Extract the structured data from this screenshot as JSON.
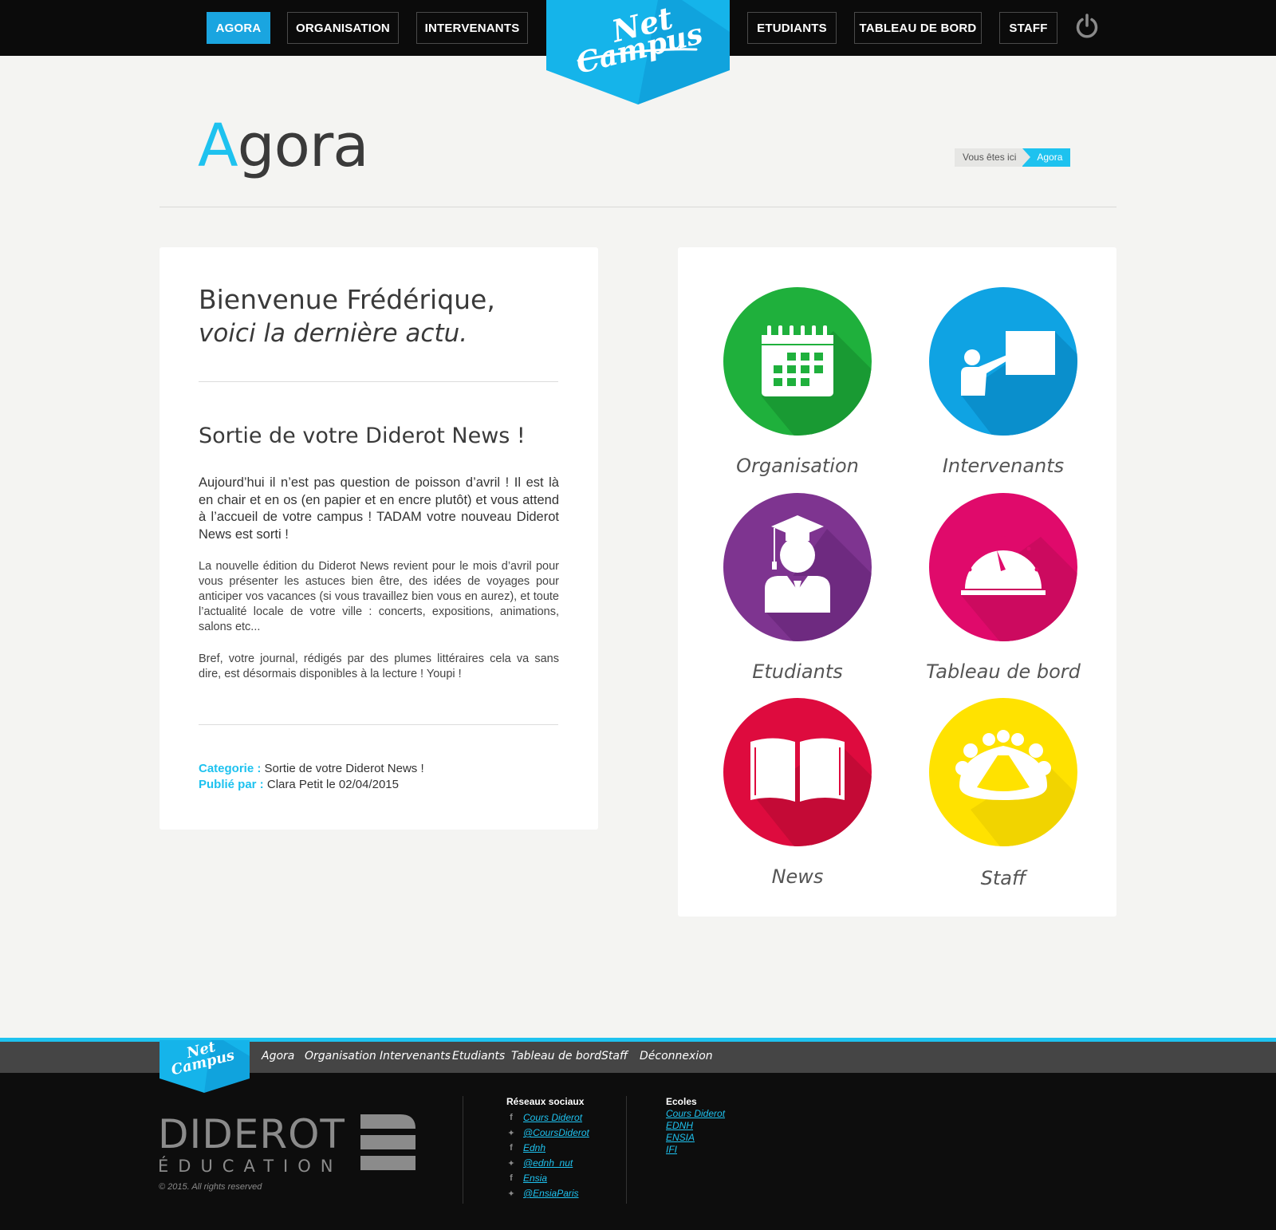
{
  "colors": {
    "accent": "#1ec2ef",
    "nav_active": "#1aa5e0",
    "topbar": "#0b0b0b",
    "green": "#1fb03c",
    "blue": "#0fa3e3",
    "purple": "#7e3490",
    "pink": "#e00a6b",
    "red": "#de0b3e",
    "yellow": "#ffe200"
  },
  "logo": {
    "line1": "Net",
    "line2": "Campus"
  },
  "nav": {
    "agora": "AGORA",
    "organisation": "ORGANISATION",
    "intervenants": "INTERVENANTS",
    "etudiants": "ETUDIANTS",
    "tableau": "TABLEAU DE BORD",
    "staff": "STAFF",
    "power_icon": "power-icon"
  },
  "page": {
    "title_first": "A",
    "title_rest": "gora"
  },
  "breadcrumb": {
    "label": "Vous êtes ici",
    "current": "Agora"
  },
  "article": {
    "welcome_line1": "Bienvenue Frédérique,",
    "welcome_line2": "voici la dernière actu.",
    "title": "Sortie de votre Diderot News !",
    "lead": "Aujourd’hui il n’est pas question de poisson d’avril ! Il est là en chair et en os (en papier et en encre plutôt) et vous attend à l’accueil de votre campus ! TADAM votre nouveau Diderot News est sorti !",
    "paragraph1": "La nouvelle édition du Diderot News revient pour le mois d’avril pour vous présenter les astuces bien être, des idées de voyages pour anticiper vos vacances (si vous travaillez bien vous en aurez), et toute l’actualité locale de votre ville : concerts, expositions, animations, salons etc...",
    "paragraph2": "Bref, votre journal, rédigés par des plumes littéraires cela va sans dire, est désormais disponibles à la lecture ! Youpi !",
    "category_label": "Categorie :",
    "category_value": "Sortie de votre Diderot News !",
    "published_label": "Publié par :",
    "published_value": "Clara Petit le 02/04/2015"
  },
  "tiles": {
    "organisation": {
      "label": "Organisation",
      "icon": "calendar-icon"
    },
    "intervenants": {
      "label": "Intervenants",
      "icon": "teacher-icon"
    },
    "etudiants": {
      "label": "Etudiants",
      "icon": "graduate-icon"
    },
    "tableau": {
      "label": "Tableau de bord",
      "icon": "dashboard-gauge-icon"
    },
    "news": {
      "label": "News",
      "icon": "open-book-icon"
    },
    "staff": {
      "label": "Staff",
      "icon": "meeting-table-icon"
    }
  },
  "footer": {
    "links": {
      "agora": "Agora",
      "organisation": "Organisation",
      "intervenants": "Intervenants",
      "etudiants": "Etudiants",
      "tableau": "Tableau de bord",
      "staff": "Staff",
      "deconnexion": "Déconnexion"
    },
    "brand_line1": "DIDEROT",
    "brand_line2": "ÉDUCATION",
    "copyright": "© 2015. All rights reserved",
    "social_heading": "Réseaux sociaux",
    "social": [
      {
        "icon": "facebook-icon",
        "text": "Cours Diderot"
      },
      {
        "icon": "twitter-icon",
        "text": "@CoursDiderot"
      },
      {
        "icon": "facebook-icon",
        "text": "Ednh"
      },
      {
        "icon": "twitter-icon",
        "text": "@ednh_nut"
      },
      {
        "icon": "facebook-icon",
        "text": "Ensia"
      },
      {
        "icon": "twitter-icon",
        "text": "@EnsiaParis"
      }
    ],
    "schools_heading": "Ecoles",
    "schools": [
      "Cours Diderot",
      "EDNH",
      "ENSIA",
      "IFI"
    ]
  }
}
